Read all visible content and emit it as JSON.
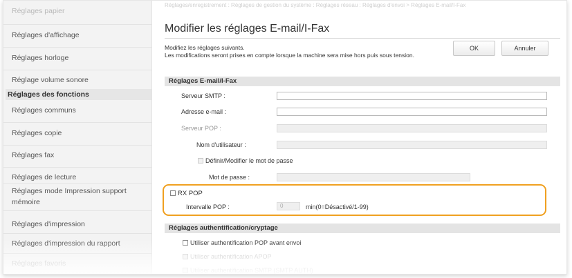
{
  "sidebar": {
    "items": [
      {
        "label": "Réglages papier"
      },
      {
        "label": "Réglages d'affichage"
      },
      {
        "label": "Réglages horloge"
      },
      {
        "label": "Réglage volume sonore"
      },
      {
        "label": "Réglages des fonctions"
      },
      {
        "label": "Réglages communs"
      },
      {
        "label": "Réglages copie"
      },
      {
        "label": "Réglages fax"
      },
      {
        "label": "Réglages de lecture"
      },
      {
        "label": "Réglages mode Impression support mémoire"
      },
      {
        "label": "Réglages d'impression"
      },
      {
        "label": "Réglages d'impression du rapport"
      },
      {
        "label": "Réglages favoris"
      }
    ]
  },
  "breadcrumb": "Réglages/enregistrement : Réglages de gestion du système : Réglages réseau : Réglages d'envoi > Réglages E-mail/I-Fax",
  "page": {
    "title": "Modifier les réglages E-mail/I-Fax",
    "description_line1": "Modifiez les réglages suivants.",
    "description_line2": "Les modifications seront prises en compte lorsque la machine sera mise hors puis sous tension.",
    "ok_label": "OK",
    "cancel_label": "Annuler"
  },
  "section1": {
    "heading": "Réglages E-mail/I-Fax",
    "smtp_label": "Serveur SMTP :",
    "smtp_value": "",
    "email_label": "Adresse e-mail :",
    "email_value": "",
    "pop_label": "Serveur POP :",
    "username_label": "Nom d'utilisateur :",
    "set_password_label": "Définir/Modifier le mot de passe",
    "password_label": "Mot de passe :",
    "rx_pop_label": "RX POP",
    "interval_label": "Intervalle POP :",
    "interval_value": "0",
    "interval_unit": "min(0=Désactivé/1-99)"
  },
  "section2": {
    "heading": "Réglages authentification/cryptage",
    "opt1": "Utiliser authentification POP avant envoi",
    "opt2": "Utiliser authentification APOP",
    "opt3": "Utiliser authentification SMTP (SMTP AUTH)"
  },
  "colors": {
    "highlight": "#f0a020",
    "section_bg": "#e4e4e4",
    "sidebar_bg": "#f3f3f3"
  }
}
